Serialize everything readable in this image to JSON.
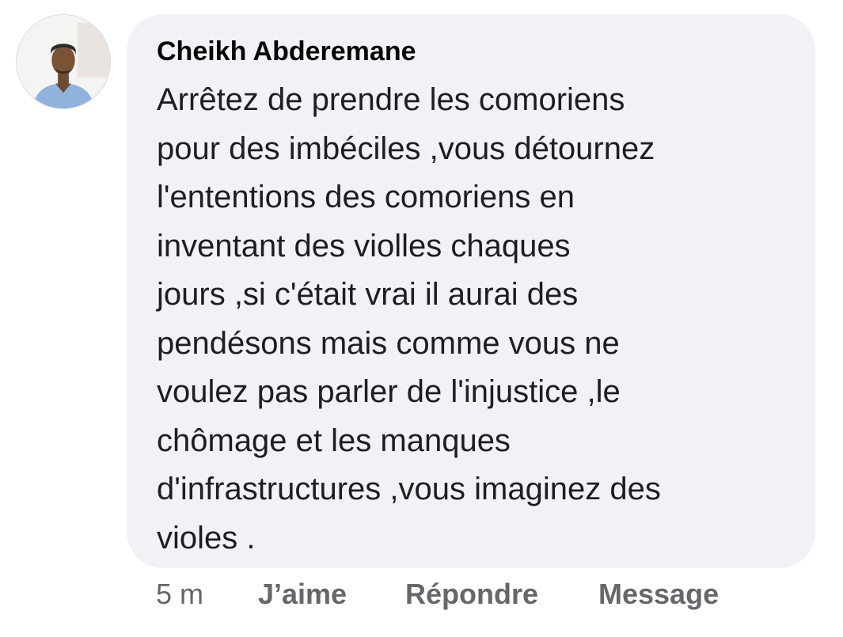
{
  "comment": {
    "author": "Cheikh Abderemane",
    "text_lines": [
      "Arrêtez de prendre les comoriens",
      "pour des imbéciles ,vous détournez",
      "l'ententions des comoriens en",
      "inventant des violles chaques",
      "jours ,si c'était vrai il aurai des",
      "pendésons mais comme vous ne",
      "voulez pas parler de l'injustice ,le",
      "chômage et les manques",
      "d'infrastructures ,vous imaginez des",
      "violes ."
    ],
    "avatar_icon": "profile-photo",
    "bubble_color": "#f0f2f5"
  },
  "actions": {
    "timestamp": "5 m",
    "like_label": "J’aime",
    "reply_label": "Répondre",
    "message_label": "Message",
    "color": "#65676b"
  }
}
